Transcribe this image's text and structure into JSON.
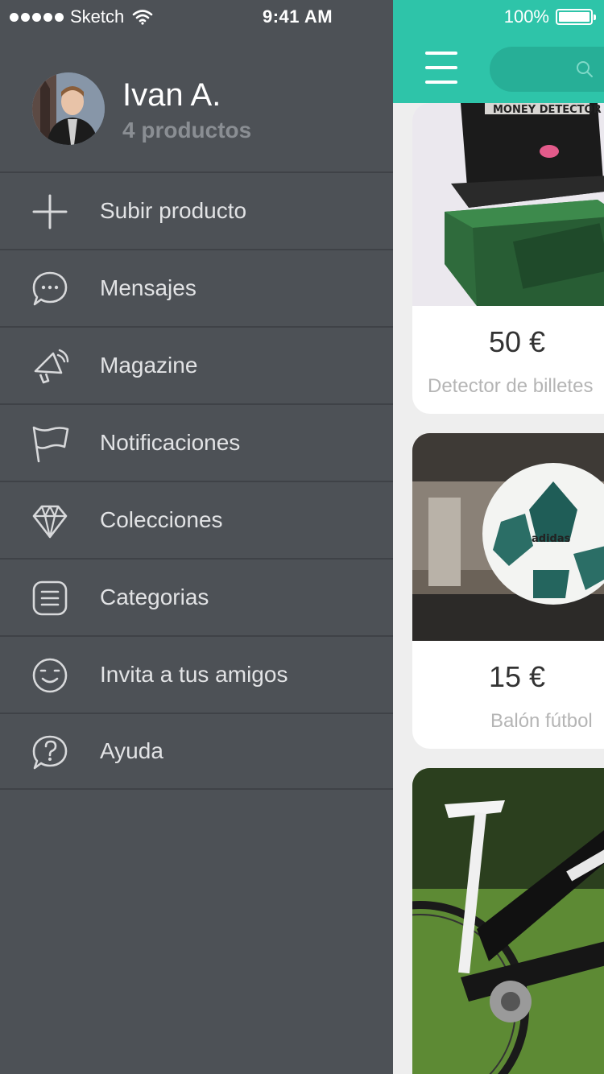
{
  "status_bar": {
    "carrier": "Sketch",
    "time": "9:41 AM",
    "battery": "100%"
  },
  "profile": {
    "name": "Ivan A.",
    "products": "4 productos"
  },
  "menu": {
    "items": [
      {
        "label": "Subir producto",
        "icon": "plus-icon"
      },
      {
        "label": "Mensajes",
        "icon": "chat-bubble-icon"
      },
      {
        "label": "Magazine",
        "icon": "megaphone-icon"
      },
      {
        "label": "Notificaciones",
        "icon": "flag-icon"
      },
      {
        "label": "Colecciones",
        "icon": "diamond-icon"
      },
      {
        "label": "Categorias",
        "icon": "list-icon"
      },
      {
        "label": "Invita a tus amigos",
        "icon": "smiley-icon"
      },
      {
        "label": "Ayuda",
        "icon": "help-bubble-icon"
      }
    ]
  },
  "products": [
    {
      "price": "50 €",
      "title": "Detector de billetes"
    },
    {
      "price": "15 €",
      "title": "Balón fútbol"
    },
    {
      "price": "",
      "title": ""
    }
  ],
  "colors": {
    "drawer_bg": "#4d5156",
    "accent": "#2ec4a9",
    "divider": "#3f4247"
  }
}
